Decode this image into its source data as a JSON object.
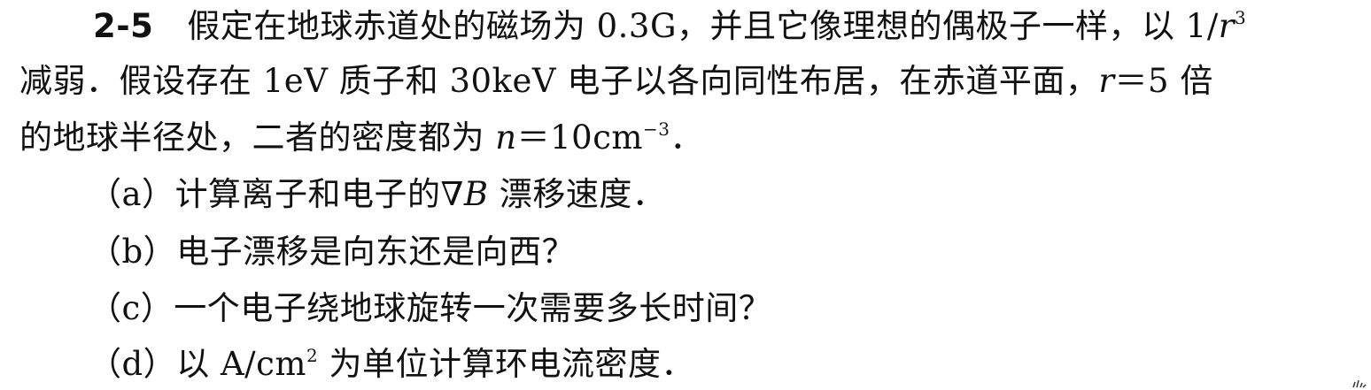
{
  "problem": {
    "number": "2-5",
    "line1": "假定在地球赤道处的磁场为 0.3G，并且它像理想的偶极子一样，以 1/",
    "line1_var": "r",
    "line1_exp": "3",
    "line2_a": "减弱．假设存在 1eV 质子和 30keV 电子以各向同性布居，在赤道平面，",
    "line2_var": "r",
    "line2_b": "＝5 倍",
    "line3_a": "的地球半径处，二者的密度都为 ",
    "line3_var": "n",
    "line3_b": "＝10cm",
    "line3_exp": "−3",
    "line3_end": "．"
  },
  "questions": {
    "a_label": "（a）",
    "a_text1": "计算离子和电子的∇",
    "a_var": "B",
    "a_text2": " 漂移速度．",
    "b_label": "（b）",
    "b_text": "电子漂移是向东还是向西？",
    "c_label": "（c）",
    "c_text": "一个电子绕地球旋转一次需要多长时间？",
    "d_label": "（d）",
    "d_text1": "以 A/cm",
    "d_exp": "2",
    "d_text2": " 为单位计算环电流密度．"
  }
}
